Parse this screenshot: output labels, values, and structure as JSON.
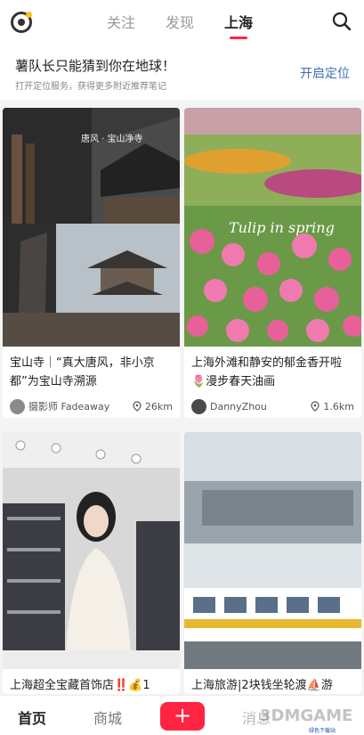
{
  "header": {
    "tabs": [
      {
        "label": "关注"
      },
      {
        "label": "发现"
      },
      {
        "label": "上海"
      }
    ],
    "active_tab": "上海",
    "accent": "#ff2442"
  },
  "banner": {
    "title": "薯队长只能猜到你在地球！",
    "subtitle": "打开定位服务，获得更多附近推荐笔记",
    "action": "开启定位"
  },
  "feed": [
    {
      "title": "宝山寺｜“真大唐风，非小京都”为宝山寺溯源",
      "image_text": "唐风 · 宝山净寺",
      "author": "摄影师 Fadeaway",
      "distance": "26km"
    },
    {
      "title": "上海外滩和静安的郁金香开啦🌷漫步春天油画",
      "image_text": "Tulip in spring",
      "author": "DannyZhou",
      "distance": "1.6km"
    },
    {
      "title": "上海超全宝藏首饰店‼️💰1"
    },
    {
      "title": "上海旅游|2块钱坐轮渡⛵游"
    }
  ],
  "bottom_nav": {
    "home": "首页",
    "mall": "商城",
    "add": "+",
    "messages": "消息"
  },
  "watermark": {
    "brand": "3DMGAME",
    "corner": "绿色下载站"
  }
}
